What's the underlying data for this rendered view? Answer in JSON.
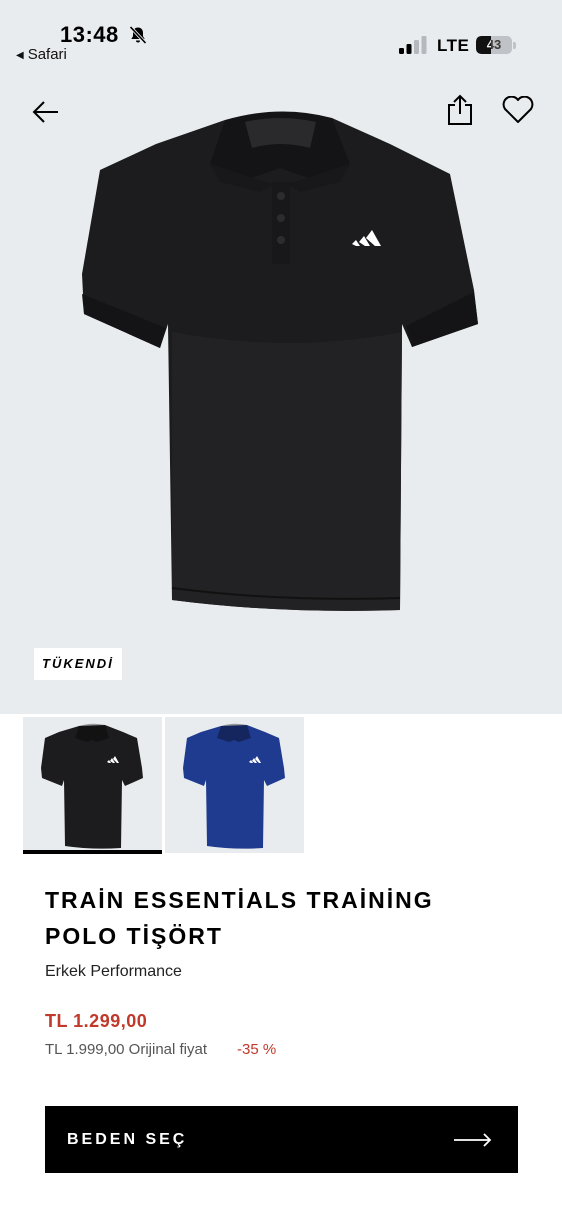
{
  "status_bar": {
    "time": "13:48",
    "back_app": "Safari",
    "network": "LTE",
    "battery": "43",
    "battery_level": 0.43
  },
  "hero": {
    "sold_out_badge": "TÜKENDİ"
  },
  "thumbnails": [
    {
      "color": "#1c1c1e",
      "selected": true
    },
    {
      "color": "#1f3b8f",
      "selected": false
    }
  ],
  "product": {
    "title_line1": "TRAİN ESSENTİALS TRAİNİNG",
    "title_line2": "POLO TİŞÖRT",
    "category": "Erkek Performance",
    "sale_price": "TL 1.299,00",
    "original_price": "TL 1.999,00 Orijinal fiyat",
    "discount": "-35 %"
  },
  "cta": {
    "label": "BEDEN SEÇ"
  },
  "colors": {
    "background_gray": "#e9ecef",
    "price_red": "#c0392b",
    "button_black": "#000000"
  },
  "icons": [
    "bell-slash-icon",
    "signal-icon",
    "battery-icon",
    "back-arrow-icon",
    "share-icon",
    "heart-icon",
    "arrow-right-icon"
  ]
}
